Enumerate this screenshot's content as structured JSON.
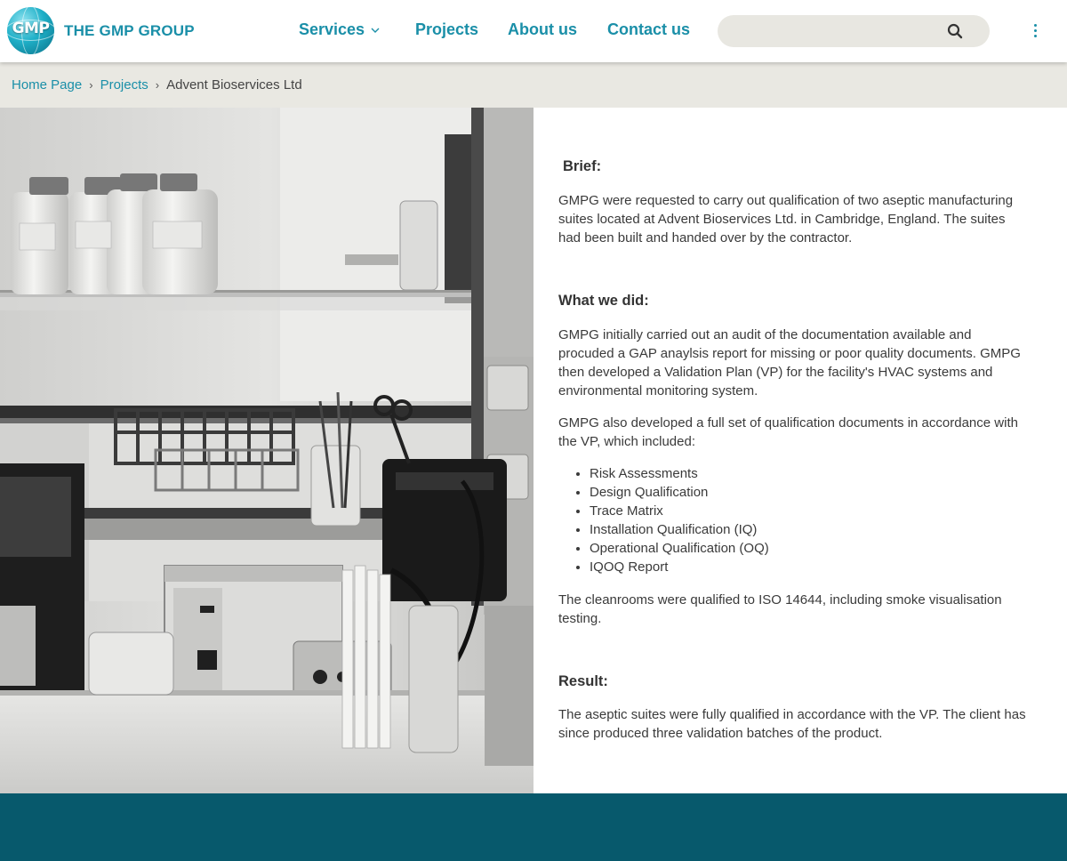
{
  "header": {
    "brand_mark": "GMP",
    "brand_name": "THE GMP GROUP",
    "nav": {
      "services": "Services",
      "projects": "Projects",
      "about": "About us",
      "contact": "Contact us"
    },
    "search_value": ""
  },
  "breadcrumb": {
    "home": "Home Page",
    "projects": "Projects",
    "current": "Advent Bioservices Ltd",
    "separator": "›"
  },
  "article": {
    "brief_heading": "Brief:",
    "brief_text": "GMPG were requested to carry out qualification of two aseptic manufacturing suites located at Advent Bioservices Ltd. in Cambridge, England. The suites had been built and handed over by the contractor.",
    "what_heading": "What we did:",
    "what_p1": "GMPG initially carried out an audit of the documentation available and procuded a GAP anaylsis report for missing or poor quality documents. GMPG then developed a Validation Plan (VP) for the facility's HVAC systems and environmental monitoring system.",
    "what_p2": "GMPG also developed a full set of qualification documents in accordance with the VP, which included:",
    "deliverables": [
      "Risk Assessments",
      "Design Qualification",
      "Trace Matrix",
      "Installation Qualification (IQ)",
      "Operational Qualification (OQ)",
      "IQOQ Report"
    ],
    "what_p3": "The cleanrooms were qualified to ISO 14644, including smoke visualisation testing.",
    "result_heading": "Result:",
    "result_text": "The aseptic suites were fully qualified in accordance with the VP. The client has since produced three validation batches of the product."
  },
  "colors": {
    "accent": "#1a8fa8",
    "breadcrumb_bg": "#e9e8e2",
    "search_bg": "#e8e7e1",
    "footer_bg": "#07596c"
  },
  "icons": {
    "logo": "globe-logo-icon",
    "services_dropdown": "chevron-down-icon",
    "search": "search-icon",
    "more": "vertical-dots-icon",
    "breadcrumb_separator": "chevron-right-icon"
  }
}
